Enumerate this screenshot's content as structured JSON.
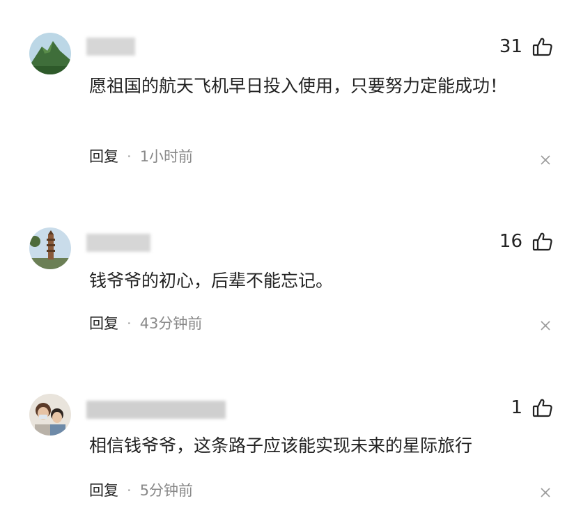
{
  "comments": [
    {
      "likes": "31",
      "text": "愿祖国的航天飞机早日投入使用，只要努力定能成功！",
      "reply_label": "回复",
      "separator": "·",
      "time": "1小时前"
    },
    {
      "likes": "16",
      "text": "钱爷爷的初心，后辈不能忘记。",
      "reply_label": "回复",
      "separator": "·",
      "time": "43分钟前"
    },
    {
      "likes": "1",
      "text": "相信钱爷爷，这条路子应该能实现未来的星际旅行",
      "reply_label": "回复",
      "separator": "·",
      "time": "5分钟前"
    }
  ],
  "icons": {
    "like": "thumbs-up-icon",
    "close": "close-icon"
  },
  "colors": {
    "text": "#222222",
    "meta": "#888888",
    "background": "#ffffff"
  }
}
